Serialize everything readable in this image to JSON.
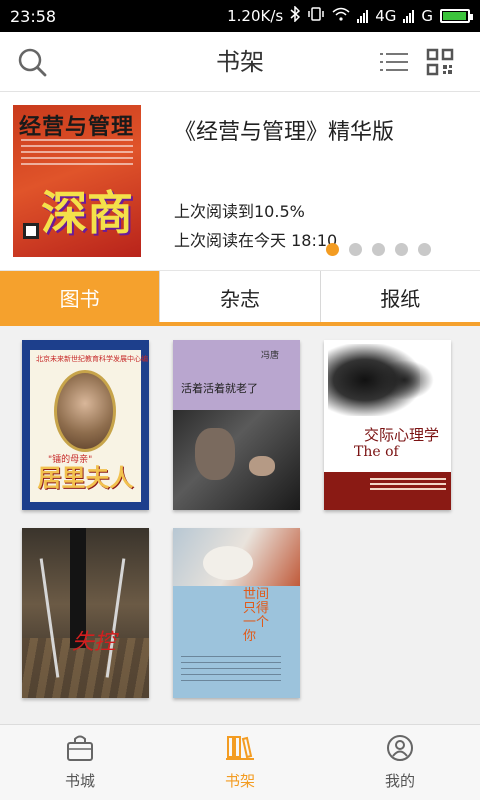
{
  "status_bar": {
    "time": "23:58",
    "speed": "1.20K/s",
    "network": "4G",
    "network2": "G"
  },
  "header": {
    "title": "书架",
    "icons": [
      "search-icon",
      "list-icon",
      "qr-code-icon"
    ]
  },
  "featured": {
    "title": "《经营与管理》精华版",
    "progress_text": "上次阅读到10.5%",
    "last_read_text": "上次阅读在今天 18:10",
    "progress": 0.105,
    "carousel": {
      "count": 5,
      "active_index": 0
    },
    "cover": {
      "masthead": "经营与管理",
      "headline": "深商"
    }
  },
  "tabs": [
    {
      "label": "图书",
      "active": true
    },
    {
      "label": "杂志",
      "active": false
    },
    {
      "label": "报纸",
      "active": false
    }
  ],
  "books": [
    {
      "cover_title": "居里夫人",
      "cover_top": "北京未来新世纪教育科学发展中心编",
      "cover_sub": "\"镭的母亲\""
    },
    {
      "cover_title": "活着活着就老了",
      "cover_author": "冯唐"
    },
    {
      "cover_title": "交际心理学",
      "cover_en": "The of"
    },
    {
      "cover_title": "失控"
    },
    {
      "cover_title": "世间只得一个你"
    }
  ],
  "bottom_nav": [
    {
      "label": "书城",
      "icon": "bag-icon",
      "active": false
    },
    {
      "label": "书架",
      "icon": "bookshelf-icon",
      "active": true
    },
    {
      "label": "我的",
      "icon": "user-icon",
      "active": false
    }
  ],
  "colors": {
    "accent": "#f5a12d",
    "dot_inactive": "#c9c9c9",
    "grid_bg": "#f1f1f1"
  }
}
